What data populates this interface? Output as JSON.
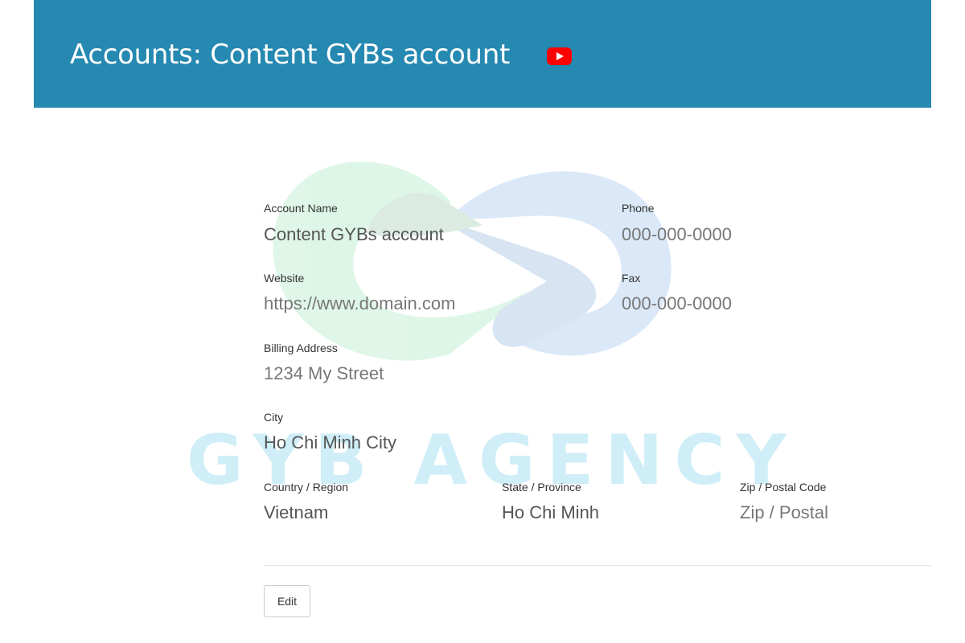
{
  "header": {
    "title": "Accounts: Content GYBs account",
    "icon": "youtube-icon",
    "background": "#2589b1"
  },
  "watermark": {
    "text": "GYB AGENCY"
  },
  "fields": {
    "account_name": {
      "label": "Account Name",
      "value": "Content GYBs account"
    },
    "phone": {
      "label": "Phone",
      "value": "000-000-0000"
    },
    "website": {
      "label": "Website",
      "value": "https://www.domain.com"
    },
    "fax": {
      "label": "Fax",
      "value": "000-000-0000"
    },
    "billing_address": {
      "label": "Billing Address",
      "value": "1234 My Street"
    },
    "city": {
      "label": "City",
      "value": "Ho Chi Minh City"
    },
    "country": {
      "label": "Country / Region",
      "value": "Vietnam"
    },
    "state": {
      "label": "State / Province",
      "value": "Ho Chi Minh"
    },
    "zip": {
      "label": "Zip / Postal Code",
      "value": "Zip / Postal"
    }
  },
  "actions": {
    "edit_label": "Edit"
  }
}
